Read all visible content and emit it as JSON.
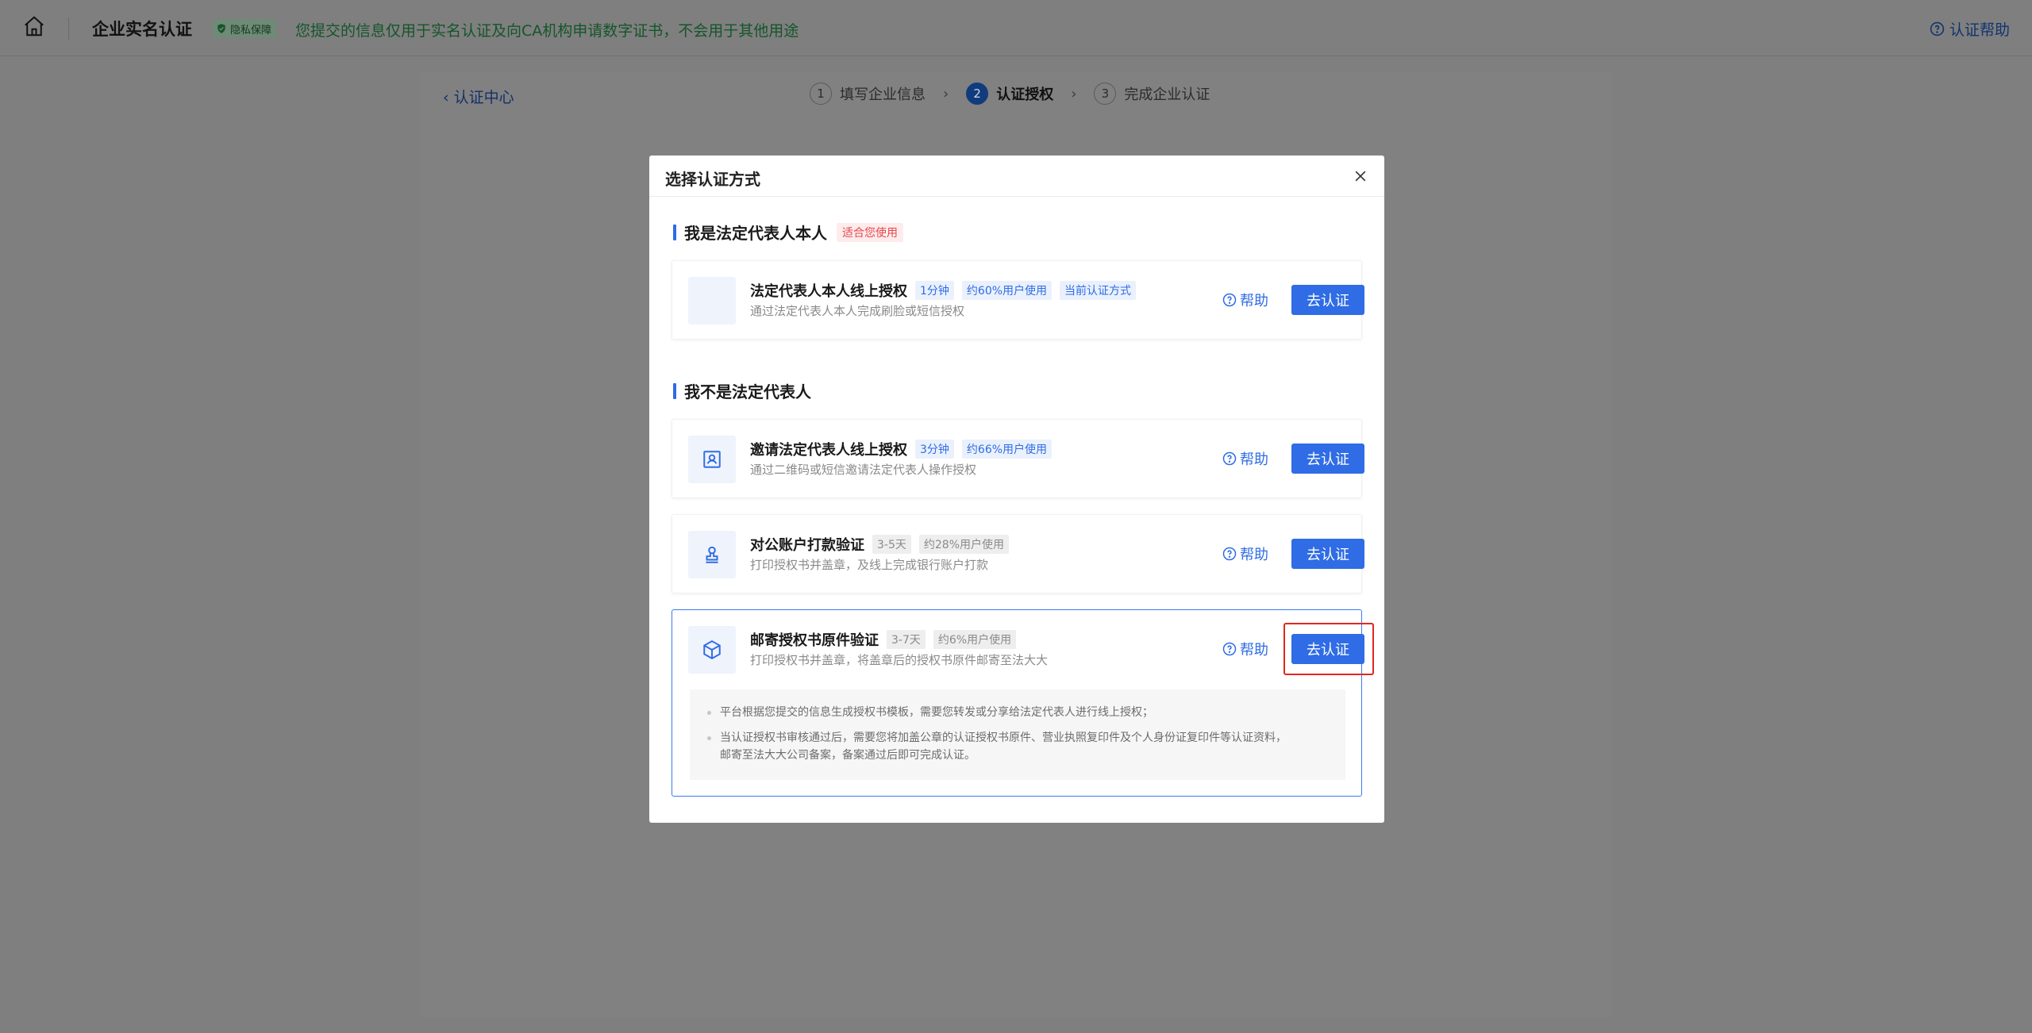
{
  "header": {
    "title": "企业实名认证",
    "privacy_badge": "隐私保障",
    "privacy_text": "您提交的信息仅用于实名认证及向CA机构申请数字证书，不会用于其他用途",
    "help_link": "认证帮助"
  },
  "background": {
    "back_link": "认证中心",
    "steps": [
      {
        "num": "1",
        "label": "填写企业信息"
      },
      {
        "num": "2",
        "label": "认证授权"
      },
      {
        "num": "3",
        "label": "完成企业认证"
      }
    ]
  },
  "modal": {
    "title": "选择认证方式",
    "section1": {
      "title": "我是法定代表人本人",
      "tag": "适合您使用"
    },
    "section2": {
      "title": "我不是法定代表人"
    },
    "options": [
      {
        "name": "法定代表人本人线上授权",
        "tags": [
          "1分钟",
          "约60%用户使用",
          "当前认证方式"
        ],
        "desc": "通过法定代表人本人完成刷脸或短信授权",
        "help": "帮助",
        "button": "去认证",
        "icon": "blank-icon"
      },
      {
        "name": "邀请法定代表人线上授权",
        "tags": [
          "3分钟",
          "约66%用户使用"
        ],
        "desc": "通过二维码或短信邀请法定代表人操作授权",
        "help": "帮助",
        "button": "去认证",
        "icon": "invite-icon"
      },
      {
        "name": "对公账户打款验证",
        "tags": [
          "3-5天",
          "约28%用户使用"
        ],
        "desc": "打印授权书并盖章，及线上完成银行账户打款",
        "help": "帮助",
        "button": "去认证",
        "icon": "stamp-icon"
      },
      {
        "name": "邮寄授权书原件验证",
        "tags": [
          "3-7天",
          "约6%用户使用"
        ],
        "desc": "打印授权书并盖章，将盖章后的授权书原件邮寄至法大大",
        "help": "帮助",
        "button": "去认证",
        "icon": "package-icon",
        "notes": [
          "平台根据您提交的信息生成授权书模板，需要您转发或分享给法定代表人进行线上授权；",
          "当认证授权书审核通过后，需要您将加盖公章的认证授权书原件、营业执照复印件及个人身份证复印件等认证资料，",
          "邮寄至法大大公司备案，备案通过后即可完成认证。"
        ]
      }
    ]
  },
  "colors": {
    "accent": "#2f6ce5",
    "overlay": "#7f7f7f",
    "highlight": "#e0281f",
    "recommend_tag": "#e5484d"
  }
}
